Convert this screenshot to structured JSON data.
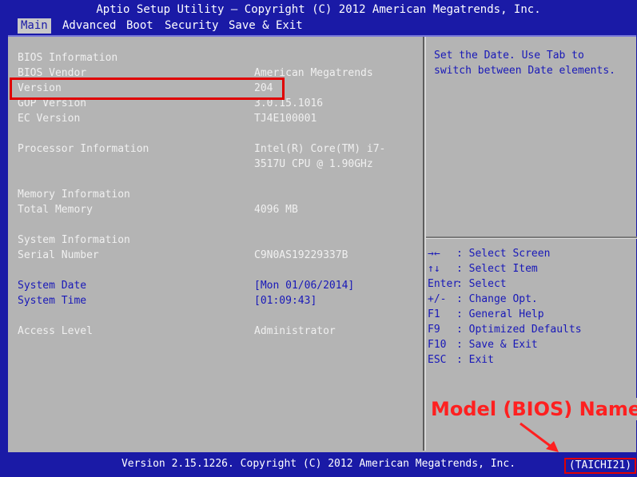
{
  "window": {
    "title": "Aptio Setup Utility – Copyright (C) 2012 American Megatrends, Inc."
  },
  "tabs": [
    {
      "label": "Main",
      "active": true
    },
    {
      "label": "Advanced",
      "active": false
    },
    {
      "label": "Boot",
      "active": false
    },
    {
      "label": "Security",
      "active": false
    },
    {
      "label": "Save & Exit",
      "active": false
    }
  ],
  "info": {
    "bios_information": "BIOS Information",
    "bios_vendor_label": "BIOS Vendor",
    "bios_vendor_value": "American Megatrends",
    "version_label": "Version",
    "version_value": "204",
    "gop_label": "GOP Version",
    "gop_value": "3.0.15.1016",
    "ec_label": "EC Version",
    "ec_value": "TJ4E100001",
    "processor_label": "Processor Information",
    "processor_value_line1": "Intel(R) Core(TM) i7-",
    "processor_value_line2": "3517U CPU @ 1.90GHz",
    "memory_information": "Memory Information",
    "total_memory_label": "Total Memory",
    "total_memory_value": "4096 MB",
    "system_information": "System Information",
    "serial_label": "Serial Number",
    "serial_value": "C9N0AS19229337B",
    "system_date_label": "System Date",
    "system_date_value": "[Mon 01/06/2014]",
    "system_time_label": "System Time",
    "system_time_value": "[01:09:43]",
    "access_label": "Access Level",
    "access_value": "Administrator"
  },
  "help": {
    "text": "Set the Date. Use Tab to switch between Date elements."
  },
  "keys": [
    {
      "key": "→←",
      "sep": ": ",
      "desc": "Select Screen"
    },
    {
      "key": "↑↓",
      "sep": ": ",
      "desc": "Select Item"
    },
    {
      "key": "Enter",
      "sep": ": ",
      "desc": "Select"
    },
    {
      "key": "+/-",
      "sep": ": ",
      "desc": "Change Opt."
    },
    {
      "key": "F1",
      "sep": ": ",
      "desc": "General Help"
    },
    {
      "key": "F9",
      "sep": ": ",
      "desc": "Optimized Defaults"
    },
    {
      "key": "F10",
      "sep": ": ",
      "desc": "Save & Exit"
    },
    {
      "key": "ESC",
      "sep": ": ",
      "desc": "Exit"
    }
  ],
  "footer": {
    "text": "Version 2.15.1226. Copyright (C) 2012 American Megatrends, Inc.",
    "model": "(TAICHI21)"
  },
  "annotation": {
    "label": "Model (BIOS) Name",
    "color": "#e00000"
  },
  "colors": {
    "background": "#1a1aa6",
    "panel": "#b4b4b4",
    "highlight_text": "#1818b8"
  }
}
